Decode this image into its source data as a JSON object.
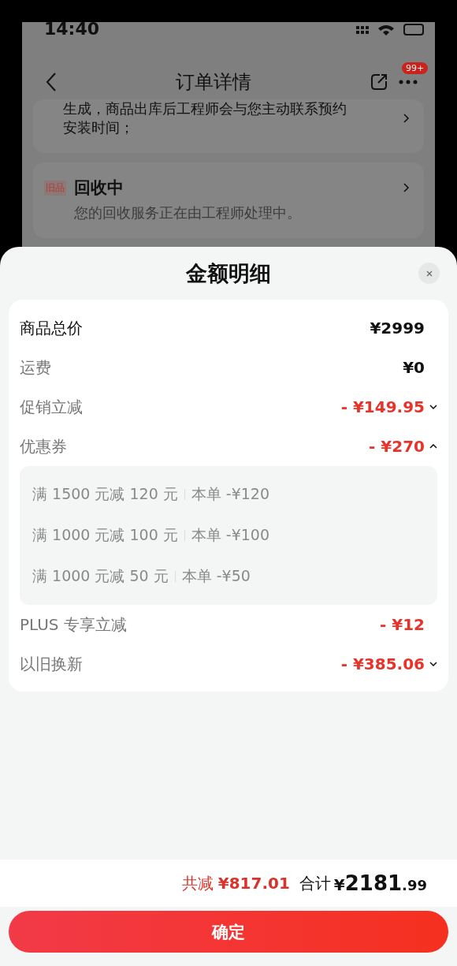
{
  "status_bar": {
    "time": "14:40"
  },
  "background_page": {
    "title": "订单详情",
    "badge": "99+",
    "service_card": {
      "lines": [
        "生成，商品出库后工程师会与您主动联系预约",
        "安装时间；"
      ]
    },
    "recycle_card": {
      "tag": "旧品",
      "title": "回收中",
      "description": "您的回收服务正在由工程师处理中。"
    }
  },
  "sheet": {
    "title": "金额明细",
    "rows": [
      {
        "kind": "main",
        "label": "商品总价",
        "value": "¥2999",
        "discount": false
      },
      {
        "kind": "normal",
        "label": "运费",
        "value": "¥0",
        "discount": false
      },
      {
        "kind": "normal",
        "label": "促销立减",
        "value": "- ¥149.95",
        "discount": true,
        "expanded": false
      },
      {
        "kind": "normal",
        "label": "优惠券",
        "value": "- ¥270",
        "discount": true,
        "expanded": true,
        "details": [
          {
            "rule": "满 1500 元减 120 元",
            "amount": "本单 -¥120"
          },
          {
            "rule": "满 1000 元减 100 元",
            "amount": "本单 -¥100"
          },
          {
            "rule": "满 1000 元减 50 元",
            "amount": "本单 -¥50"
          }
        ]
      },
      {
        "kind": "normal",
        "label": "PLUS 专享立减",
        "value": "- ¥12",
        "discount": true
      },
      {
        "kind": "normal",
        "label": "以旧换新",
        "value": "- ¥385.06",
        "discount": true,
        "expanded": false
      }
    ]
  },
  "summary": {
    "saved_label": "共减",
    "saved_value": "¥817.01",
    "total_label": "合计",
    "total_currency": "¥",
    "total_integer": "2181",
    "total_decimal": ".99"
  },
  "confirm_button": "确定"
}
